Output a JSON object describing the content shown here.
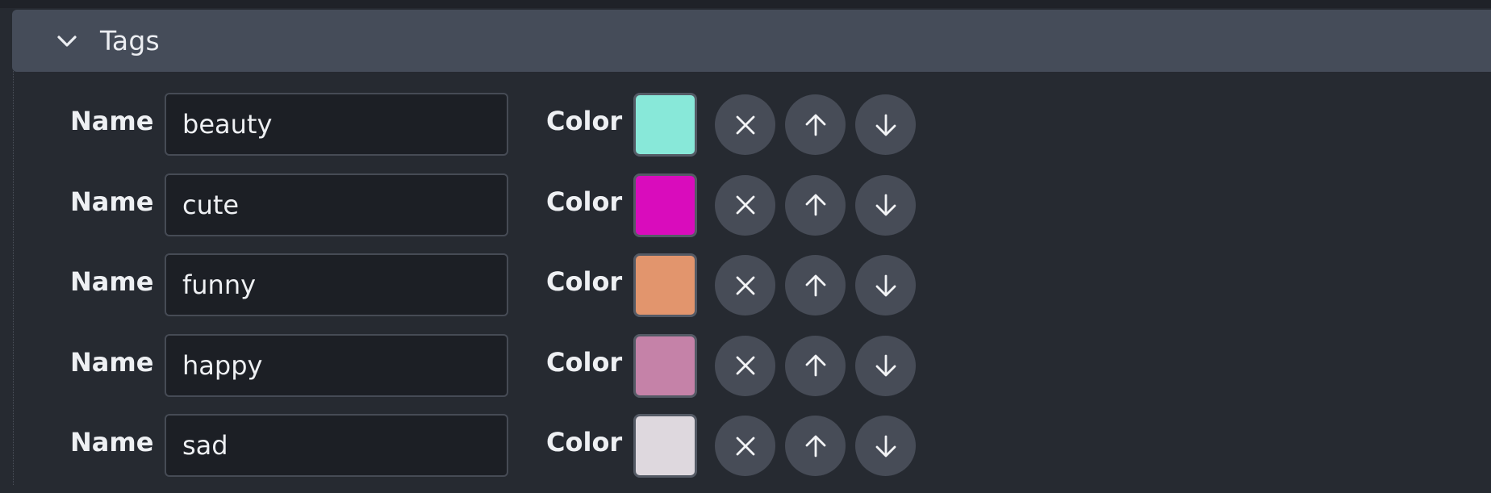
{
  "section": {
    "title": "Tags",
    "expanded": true
  },
  "labels": {
    "name": "Name",
    "color": "Color"
  },
  "icons": {
    "collapse": "chevron-down-icon",
    "remove": "close-icon",
    "move_up": "arrow-up-icon",
    "move_down": "arrow-down-icon"
  },
  "tags": [
    {
      "name": "beauty",
      "color": "#88e8d9"
    },
    {
      "name": "cute",
      "color": "#d90cbc"
    },
    {
      "name": "funny",
      "color": "#e2956d"
    },
    {
      "name": "happy",
      "color": "#c582a8"
    },
    {
      "name": "sad",
      "color": "#ded8de"
    }
  ]
}
